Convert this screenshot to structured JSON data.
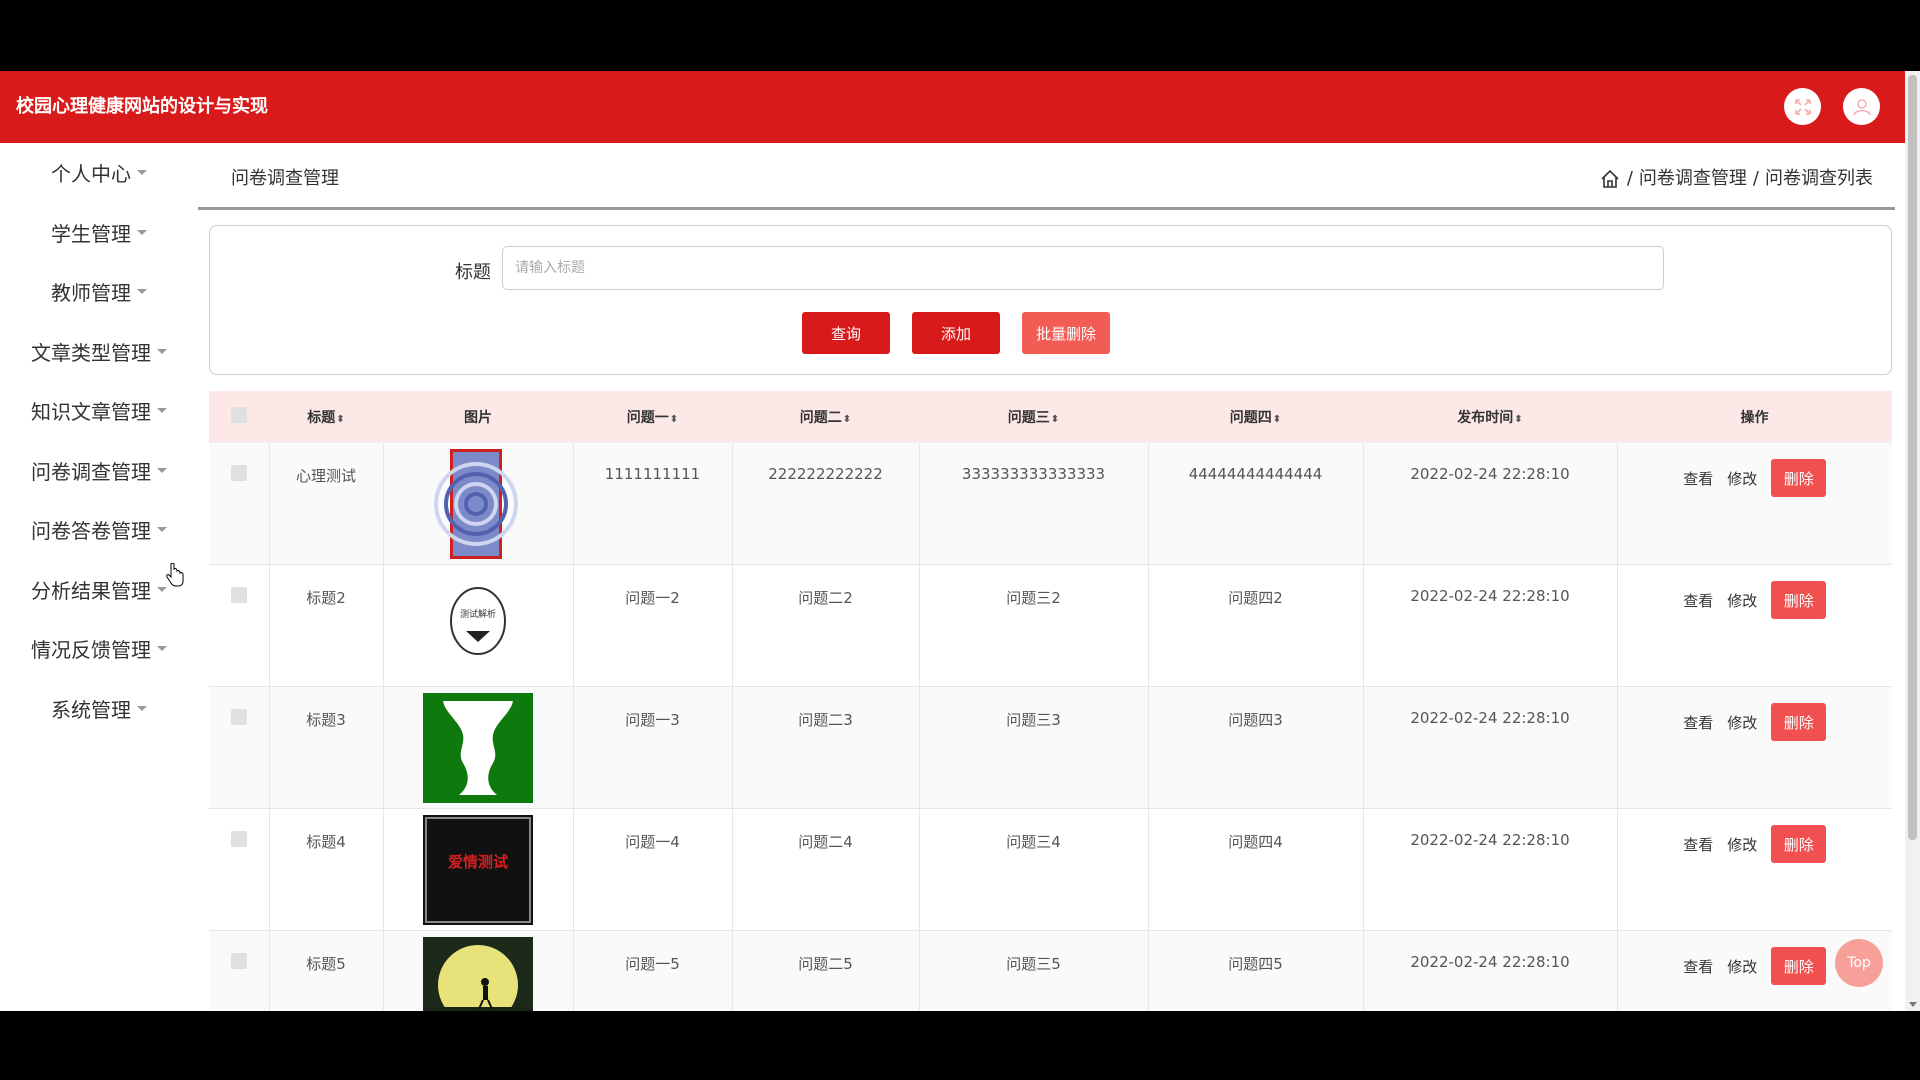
{
  "app": {
    "title": "校园心理健康网站的设计与实现"
  },
  "sidebar": {
    "items": [
      {
        "label": "个人中心"
      },
      {
        "label": "学生管理"
      },
      {
        "label": "教师管理"
      },
      {
        "label": "文章类型管理"
      },
      {
        "label": "知识文章管理"
      },
      {
        "label": "问卷调查管理"
      },
      {
        "label": "问卷答卷管理"
      },
      {
        "label": "分析结果管理"
      },
      {
        "label": "情况反馈管理"
      },
      {
        "label": "系统管理"
      }
    ]
  },
  "page": {
    "title": "问卷调查管理",
    "breadcrumb": [
      "问卷调查管理",
      "问卷调查列表"
    ],
    "separator": "/"
  },
  "search": {
    "label": "标题",
    "placeholder": "请输入标题"
  },
  "buttons": {
    "query": "查询",
    "add": "添加",
    "batch_delete": "批量删除",
    "top": "Top"
  },
  "table": {
    "columns": [
      "标题",
      "图片",
      "问题一",
      "问题二",
      "问题三",
      "问题四",
      "发布时间",
      "操作"
    ],
    "rows": [
      {
        "title": "心理测试",
        "q1": "1111111111",
        "q2": "222222222222",
        "q3": "333333333333333",
        "q4": "44444444444444",
        "time": "2022-02-24 22:28:10",
        "image": "spiral-illusion"
      },
      {
        "title": "标题2",
        "q1": "问题一2",
        "q2": "问题二2",
        "q3": "问题三2",
        "q4": "问题四2",
        "time": "2022-02-24 22:28:10",
        "image": "test-analysis",
        "image_text": "测试解析"
      },
      {
        "title": "标题3",
        "q1": "问题一3",
        "q2": "问题二3",
        "q3": "问题三3",
        "q4": "问题四3",
        "time": "2022-02-24 22:28:10",
        "image": "vase-faces"
      },
      {
        "title": "标题4",
        "q1": "问题一4",
        "q2": "问题二4",
        "q3": "问题三4",
        "q4": "问题四4",
        "time": "2022-02-24 22:28:10",
        "image": "love-test",
        "image_text": "爱情测试"
      },
      {
        "title": "标题5",
        "q1": "问题一5",
        "q2": "问题二5",
        "q3": "问题三5",
        "q4": "问题四5",
        "time": "2022-02-24 22:28:10",
        "image": "moon-scene"
      }
    ],
    "actions": {
      "view": "查看",
      "edit": "修改",
      "delete": "删除"
    }
  },
  "colors": {
    "primary": "#d81a1a",
    "batch": "#f25c54",
    "delete": "#f05050",
    "header_bg": "#fde8e8"
  }
}
